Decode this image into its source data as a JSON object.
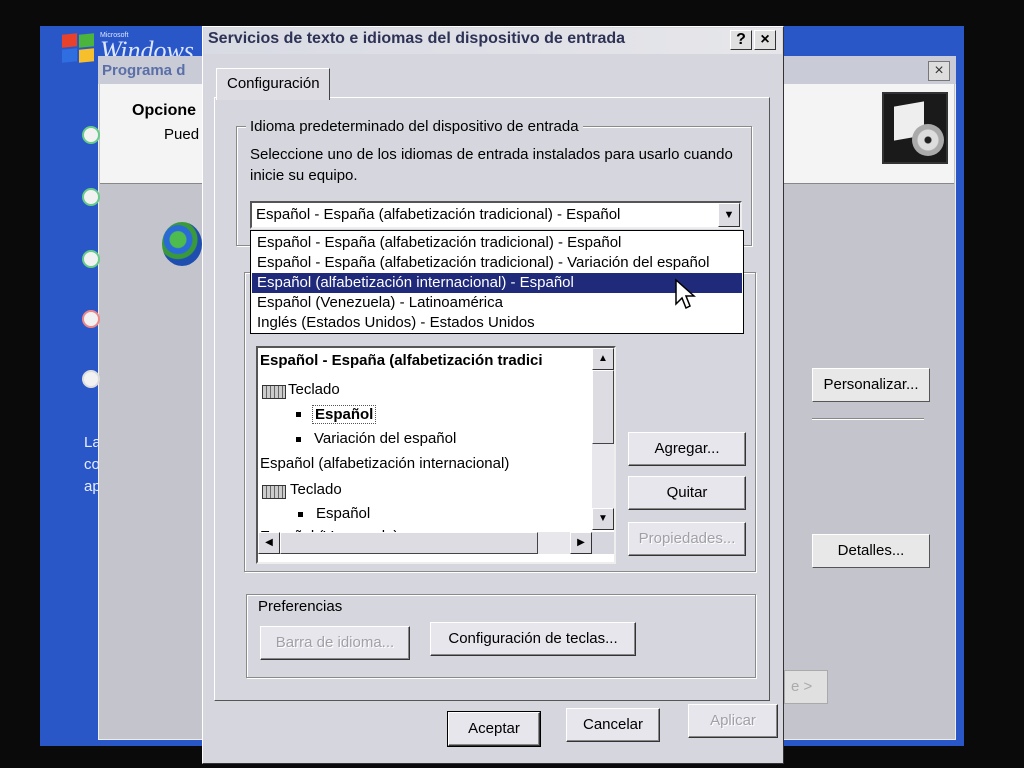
{
  "background": {
    "logo_small": "Microsoft",
    "logo_text": "Windows",
    "window_title": "Programa d",
    "header_title": "Opcione",
    "header_subtitle": "Pued",
    "close_glyph": "×",
    "left_text_lines": [
      "La",
      "co",
      "ap"
    ],
    "personalize_label": "Personalizar...",
    "details_label": "Detalles...",
    "next_label": "e >"
  },
  "dialog": {
    "title": "Servicios de texto e idiomas del dispositivo de entrada",
    "help_glyph": "?",
    "close_glyph": "×",
    "tab_label": "Configuración",
    "default_group": {
      "legend": "Idioma predeterminado del dispositivo de entrada",
      "description": "Seleccione uno de los idiomas de entrada instalados para usarlo cuando inicie su equipo.",
      "selected_value": "Español - España (alfabetización tradicional) - Español",
      "dropdown_glyph": "▼",
      "options": [
        "Español - España (alfabetización tradicional) - Español",
        "Español - España (alfabetización tradicional) - Variación del español",
        "Español (alfabetización internacional) - Español",
        "Español (Venezuela) - Latinoamérica",
        "Inglés (Estados Unidos) - Estados Unidos"
      ],
      "highlighted_index": 2
    },
    "services": {
      "tree": [
        {
          "text": "Español - España (alfabetización tradici",
          "level": 0,
          "bold": true
        },
        {
          "text": "Teclado",
          "level": 1,
          "icon": "keyboard-icon"
        },
        {
          "text": "Español",
          "level": 2,
          "bold": true,
          "bullet": true
        },
        {
          "text": "Variación del español",
          "level": 2,
          "bullet": true
        },
        {
          "text": "Español (alfabetización internacional)",
          "level": 0
        },
        {
          "text": "Teclado",
          "level": 1,
          "icon": "keyboard-icon"
        },
        {
          "text": "Español",
          "level": 2,
          "bullet": true
        },
        {
          "text": "Español (Venezuela)",
          "level": 0
        }
      ],
      "scroll_up": "▲",
      "scroll_down": "▼",
      "scroll_left": "◀",
      "scroll_right": "▶",
      "add_label": "Agregar...",
      "remove_label": "Quitar",
      "properties_label": "Propiedades..."
    },
    "preferences": {
      "legend": "Preferencias",
      "language_bar_label": "Barra de idioma...",
      "key_settings_label": "Configuración de teclas..."
    },
    "ok_label": "Aceptar",
    "cancel_label": "Cancelar",
    "apply_label": "Aplicar"
  }
}
